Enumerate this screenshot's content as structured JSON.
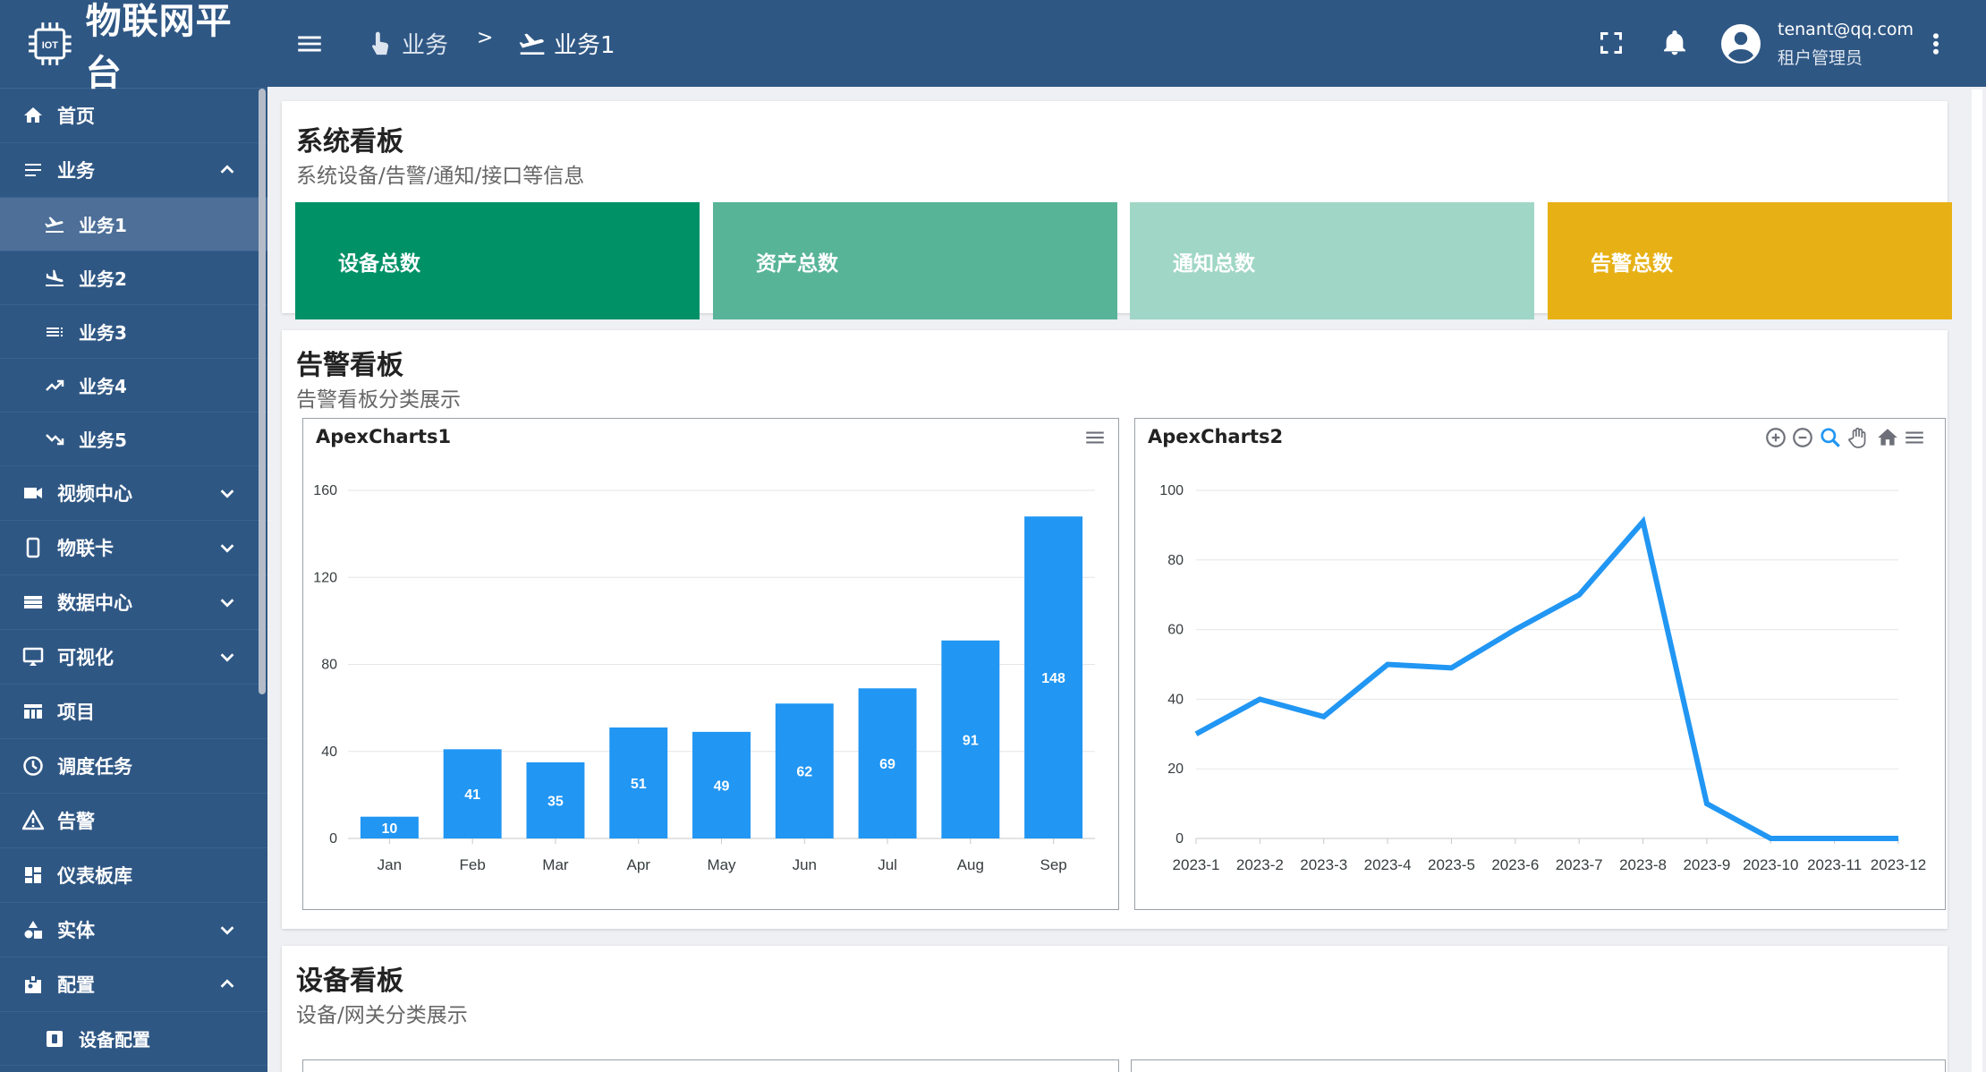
{
  "app": {
    "brand": "物联网平台",
    "logo_chip_text": "IOT"
  },
  "colors": {
    "sidebar_bg": "#2f5784",
    "accent": "#2196f3",
    "stat1": "#009167",
    "stat2": "#58b497",
    "stat3": "#a0d6c5",
    "stat4": "#e7b116"
  },
  "sidebar": {
    "items": [
      {
        "label": "首页",
        "icon": "home-icon"
      },
      {
        "label": "业务",
        "icon": "list-icon",
        "expanded": true
      },
      {
        "label": "业务1",
        "icon": "plane-takeoff-icon",
        "active": true
      },
      {
        "label": "业务2",
        "icon": "plane-landing-icon"
      },
      {
        "label": "业务3",
        "icon": "list-lines-icon"
      },
      {
        "label": "业务4",
        "icon": "trending-up-icon"
      },
      {
        "label": "业务5",
        "icon": "trending-down-icon"
      },
      {
        "label": "视频中心",
        "icon": "video-icon"
      },
      {
        "label": "物联卡",
        "icon": "phone-icon"
      },
      {
        "label": "数据中心",
        "icon": "storage-icon"
      },
      {
        "label": "可视化",
        "icon": "airplay-icon"
      },
      {
        "label": "项目",
        "icon": "table-icon"
      },
      {
        "label": "调度任务",
        "icon": "clock-icon"
      },
      {
        "label": "告警",
        "icon": "warning-icon"
      },
      {
        "label": "仪表板库",
        "icon": "dashboard-icon"
      },
      {
        "label": "实体",
        "icon": "shapes-icon"
      },
      {
        "label": "配置",
        "icon": "badge-icon",
        "expanded": true
      },
      {
        "label": "设备配置",
        "icon": "device-config-icon"
      }
    ]
  },
  "topbar": {
    "breadcrumb": [
      {
        "label": "业务",
        "icon": "touch-icon"
      },
      {
        "label": "业务1",
        "icon": "plane-takeoff-icon"
      }
    ],
    "separator": ">",
    "user_email": "tenant@qq.com",
    "user_role": "租户管理员"
  },
  "system_board": {
    "title": "系统看板",
    "subtitle": "系统设备/告警/通知/接口等信息",
    "stats": [
      {
        "label": "设备总数"
      },
      {
        "label": "资产总数"
      },
      {
        "label": "通知总数"
      },
      {
        "label": "告警总数"
      }
    ]
  },
  "alert_board": {
    "title": "告警看板",
    "subtitle": "告警看板分类展示",
    "chart1_title": "ApexCharts1",
    "chart2_title": "ApexCharts2"
  },
  "device_board": {
    "title": "设备看板",
    "subtitle": "设备/网关分类展示"
  },
  "chart_data": [
    {
      "type": "bar",
      "title": "ApexCharts1",
      "categories": [
        "Jan",
        "Feb",
        "Mar",
        "Apr",
        "May",
        "Jun",
        "Jul",
        "Aug",
        "Sep"
      ],
      "values": [
        10,
        41,
        35,
        51,
        49,
        62,
        69,
        91,
        148
      ],
      "yticks": [
        "0",
        "40",
        "80",
        "120",
        "160"
      ],
      "ylim": [
        0,
        160
      ],
      "grid": true,
      "color": "#2196f3"
    },
    {
      "type": "line",
      "title": "ApexCharts2",
      "x": [
        "2023-1",
        "2023-2",
        "2023-3",
        "2023-4",
        "2023-5",
        "2023-6",
        "2023-7",
        "2023-8",
        "2023-9",
        "2023-10",
        "2023-11",
        "2023-12"
      ],
      "values": [
        30,
        40,
        35,
        50,
        49,
        60,
        70,
        91,
        10,
        0,
        0,
        0
      ],
      "yticks": [
        "0",
        "20",
        "40",
        "60",
        "80",
        "100"
      ],
      "ylim": [
        0,
        100
      ],
      "grid": true,
      "color": "#2196f3"
    }
  ]
}
